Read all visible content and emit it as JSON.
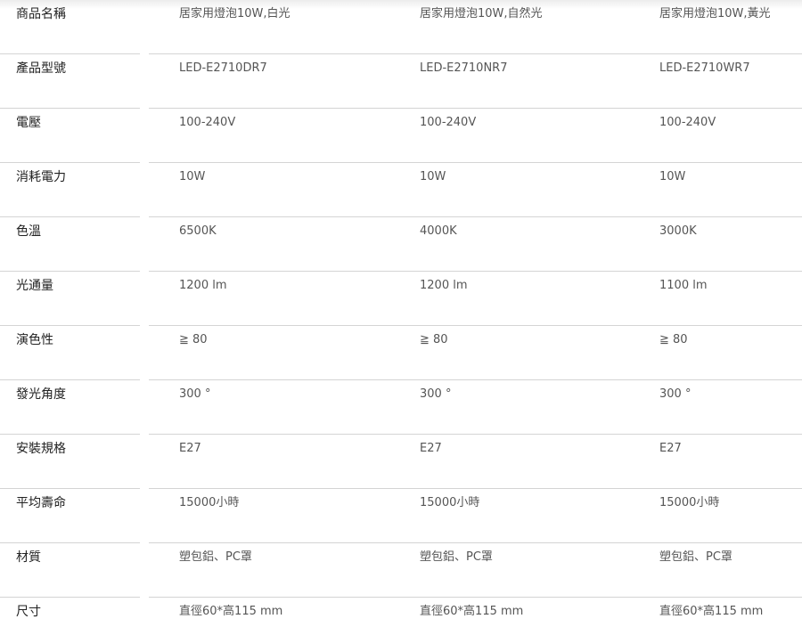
{
  "spec_table": {
    "rows": [
      {
        "label": "商品名稱",
        "values": [
          "居家用燈泡10W,白光",
          "居家用燈泡10W,自然光",
          "居家用燈泡10W,黃光"
        ]
      },
      {
        "label": "產品型號",
        "values": [
          "LED-E2710DR7",
          "LED-E2710NR7",
          "LED-E2710WR7"
        ]
      },
      {
        "label": "電壓",
        "values": [
          "100-240V",
          "100-240V",
          "100-240V"
        ]
      },
      {
        "label": "消耗電力",
        "values": [
          "10W",
          "10W",
          "10W"
        ]
      },
      {
        "label": "色溫",
        "values": [
          "6500K",
          "4000K",
          "3000K"
        ]
      },
      {
        "label": "光通量",
        "values": [
          "1200 lm",
          "1200 lm",
          "1100 lm"
        ]
      },
      {
        "label": "演色性",
        "values": [
          "≧ 80",
          "≧ 80",
          "≧ 80"
        ]
      },
      {
        "label": "發光角度",
        "values": [
          "300 °",
          "300 °",
          "300 °"
        ]
      },
      {
        "label": "安裝規格",
        "values": [
          "E27",
          "E27",
          "E27"
        ]
      },
      {
        "label": "平均壽命",
        "values": [
          "15000小時",
          "15000小時",
          "15000小時"
        ]
      },
      {
        "label": "材質",
        "values": [
          "塑包鋁、PC罩",
          "塑包鋁、PC罩",
          "塑包鋁、PC罩"
        ]
      },
      {
        "label": "尺寸",
        "values": [
          "直徑60*高115 mm",
          "直徑60*高115 mm",
          "直徑60*高115 mm"
        ]
      }
    ]
  }
}
